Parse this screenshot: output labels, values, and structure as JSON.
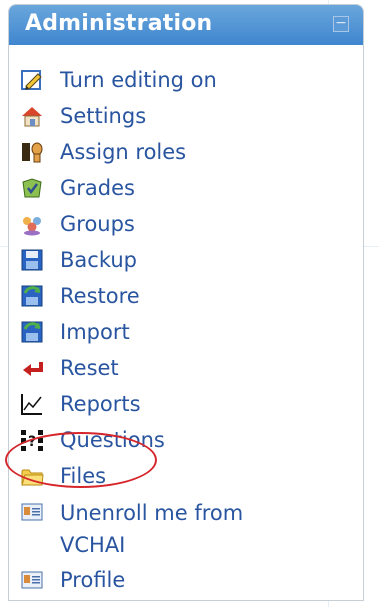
{
  "block": {
    "title": "Administration",
    "collapse_symbol": "−"
  },
  "menu": [
    {
      "label": "Turn editing on",
      "icon": "pencil-edit-icon"
    },
    {
      "label": "Settings",
      "icon": "settings-house-icon"
    },
    {
      "label": "Assign roles",
      "icon": "assign-roles-icon"
    },
    {
      "label": "Grades",
      "icon": "grades-icon"
    },
    {
      "label": "Groups",
      "icon": "groups-icon"
    },
    {
      "label": "Backup",
      "icon": "backup-disk-icon"
    },
    {
      "label": "Restore",
      "icon": "restore-disk-icon"
    },
    {
      "label": "Import",
      "icon": "import-disk-icon"
    },
    {
      "label": "Reset",
      "icon": "reset-arrow-icon"
    },
    {
      "label": "Reports",
      "icon": "reports-chart-icon"
    },
    {
      "label": "Questions",
      "icon": "questions-icon"
    },
    {
      "label": "Files",
      "icon": "folder-icon"
    },
    {
      "label": "Unenroll me from\nVCHAI",
      "icon": "unenroll-card-icon"
    },
    {
      "label": "Profile",
      "icon": "profile-card-icon"
    }
  ],
  "colors": {
    "header": "#4a8fd4",
    "link": "#2955a0",
    "highlight": "#d6262c"
  }
}
